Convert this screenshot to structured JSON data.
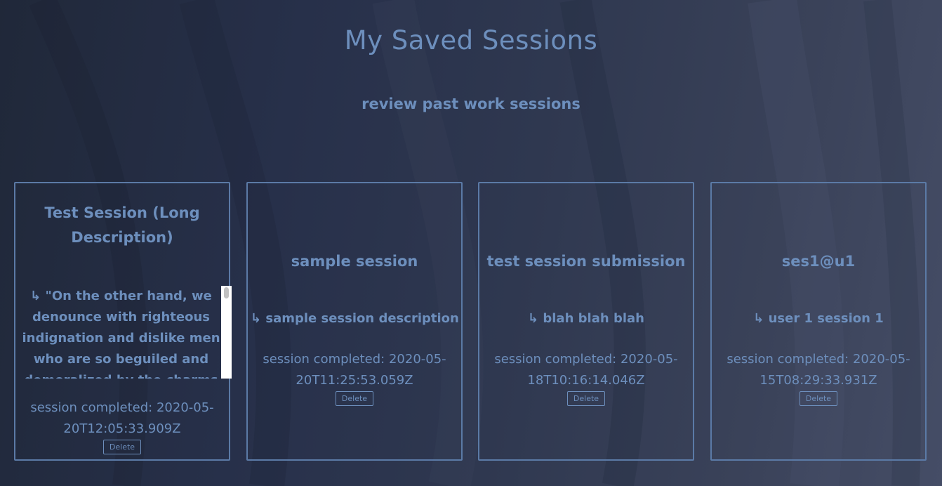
{
  "page": {
    "title": "My Saved Sessions",
    "subtitle": "review past work sessions"
  },
  "sessions": [
    {
      "title": "Test Session (Long Description)",
      "description": "↳ \"On the other hand, we denounce with righteous indignation and dislike men who are so beguiled and demoralized by the charms of",
      "completed": "session completed: 2020-05-20T12:05:33.909Z",
      "delete_label": "Delete"
    },
    {
      "title": "sample session",
      "description": "↳ sample session description",
      "completed": "session completed: 2020-05-20T11:25:53.059Z",
      "delete_label": "Delete"
    },
    {
      "title": "test session submission",
      "description": "↳ blah blah blah",
      "completed": "session completed: 2020-05-18T10:16:14.046Z",
      "delete_label": "Delete"
    },
    {
      "title": "ses1@u1",
      "description": "↳ user 1 session 1",
      "completed": "session completed: 2020-05-15T08:29:33.931Z",
      "delete_label": "Delete"
    }
  ]
}
